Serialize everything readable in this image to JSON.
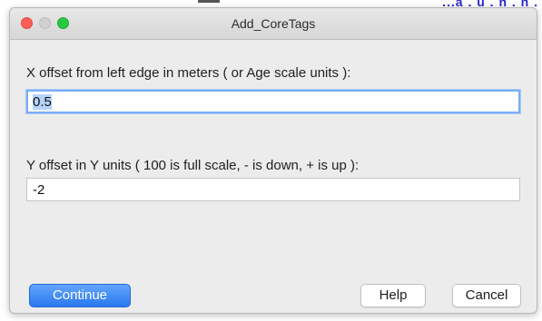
{
  "window": {
    "title": "Add_CoreTags"
  },
  "background": {
    "partial_text": "...a . u . n . n ."
  },
  "fields": [
    {
      "label": "X offset from left edge in meters ( or Age scale units ):",
      "value": "0.5",
      "focused": true
    },
    {
      "label": "Y offset in Y units ( 100 is full scale, - is down, + is up ):",
      "value": "-2",
      "focused": false
    }
  ],
  "buttons": {
    "continue_label": "Continue",
    "help_label": "Help",
    "cancel_label": "Cancel"
  },
  "colors": {
    "default_button": "#2a78f0",
    "focus_ring": "#7aaef4",
    "close": "#fc5f57",
    "zoom": "#28c840"
  }
}
